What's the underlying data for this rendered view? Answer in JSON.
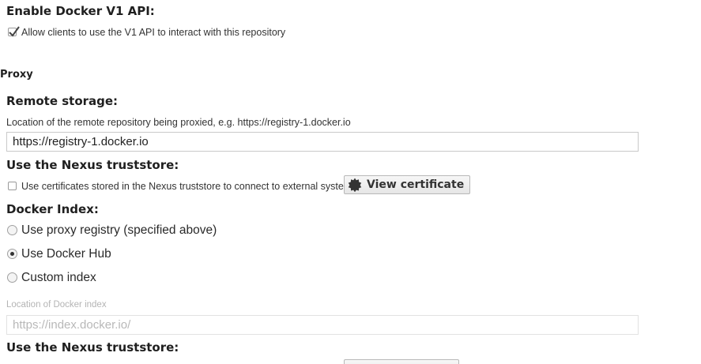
{
  "docker_v1": {
    "heading": "Enable Docker V1 API:",
    "checkbox_label": "Allow clients to use the V1 API to interact with this repository",
    "checked": true
  },
  "proxy": {
    "section_title": "Proxy",
    "remote_storage": {
      "heading": "Remote storage:",
      "help": "Location of the remote repository being proxied, e.g. https://registry-1.docker.io",
      "value": "https://registry-1.docker.io"
    },
    "truststore": {
      "heading": "Use the Nexus truststore:",
      "checkbox_label": "Use certificates stored in the Nexus truststore to connect to external systems",
      "checked": false,
      "view_certificate_label": "View certificate",
      "icon": "certificate-icon"
    },
    "docker_index": {
      "heading": "Docker Index:",
      "options": [
        {
          "label": "Use proxy registry (specified above)",
          "selected": false
        },
        {
          "label": "Use Docker Hub",
          "selected": true
        },
        {
          "label": "Custom index",
          "selected": false
        }
      ],
      "location_label": "Location of Docker index",
      "location_placeholder": "https://index.docker.io/"
    },
    "index_truststore": {
      "heading": "Use the Nexus truststore:"
    }
  }
}
